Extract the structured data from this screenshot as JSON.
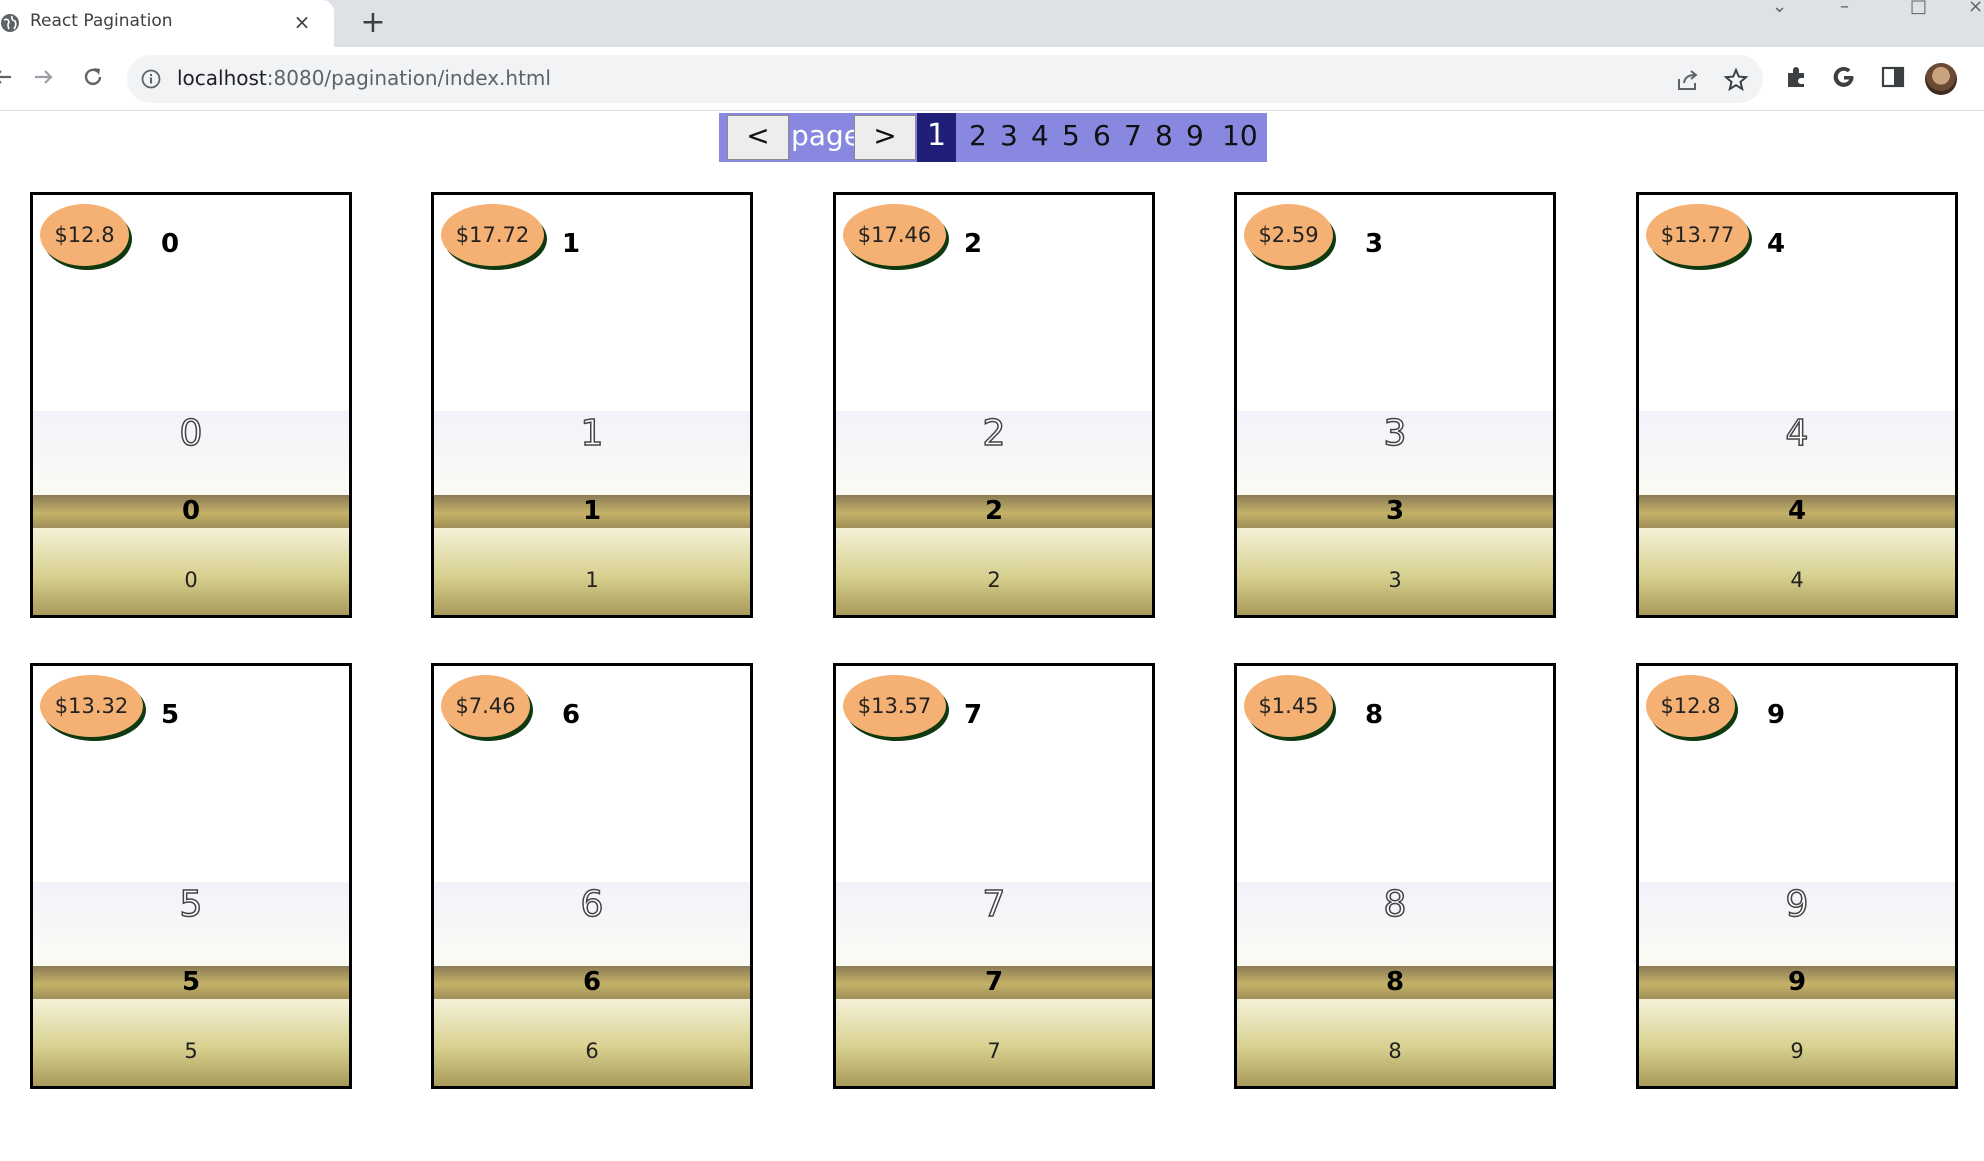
{
  "browser": {
    "tab_title": "React Pagination",
    "tab_close": "×",
    "new_tab": "+",
    "url_host": "localhost",
    "url_path": ":8080/pagination/index.html"
  },
  "pager": {
    "prev_label": "<",
    "page_label": "page",
    "next_label": ">",
    "current_page": "1",
    "pages": [
      "2",
      "3",
      "4",
      "5",
      "6",
      "7",
      "8",
      "9",
      "10"
    ]
  },
  "cards": [
    {
      "price": "$12.8",
      "index": "0",
      "outline": "0",
      "bold": "0",
      "small": "0"
    },
    {
      "price": "$17.72",
      "index": "1",
      "outline": "1",
      "bold": "1",
      "small": "1"
    },
    {
      "price": "$17.46",
      "index": "2",
      "outline": "2",
      "bold": "2",
      "small": "2"
    },
    {
      "price": "$2.59",
      "index": "3",
      "outline": "3",
      "bold": "3",
      "small": "3"
    },
    {
      "price": "$13.77",
      "index": "4",
      "outline": "4",
      "bold": "4",
      "small": "4"
    },
    {
      "price": "$13.32",
      "index": "5",
      "outline": "5",
      "bold": "5",
      "small": "5"
    },
    {
      "price": "$7.46",
      "index": "6",
      "outline": "6",
      "bold": "6",
      "small": "6"
    },
    {
      "price": "$13.57",
      "index": "7",
      "outline": "7",
      "bold": "7",
      "small": "7"
    },
    {
      "price": "$1.45",
      "index": "8",
      "outline": "8",
      "bold": "8",
      "small": "8"
    },
    {
      "price": "$12.8",
      "index": "9",
      "outline": "9",
      "bold": "9",
      "small": "9"
    }
  ]
}
